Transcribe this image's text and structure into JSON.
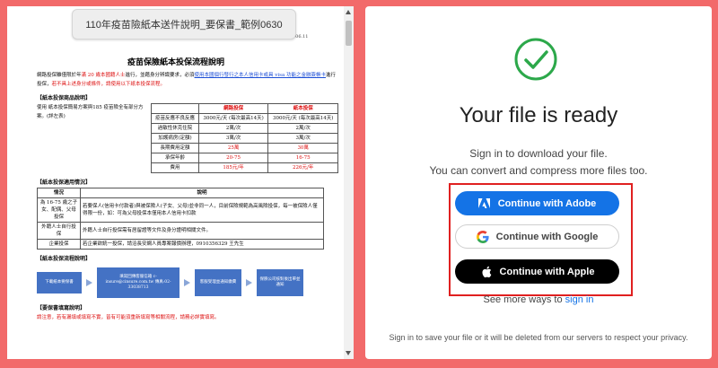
{
  "preview": {
    "file_name": "110年疫苗險紙本送件說明_要保書_範例0630",
    "date": "110.06.11",
    "doc_title": "疫苗保險紙本投保流程說明",
    "intro_1": "網路投保雖僅限於年",
    "intro_red": "滿 20 歲本國籍人士",
    "intro_2": "進行，並藉身分辨識要求，必須",
    "intro_blue": "使用本國個行發行之本人信用卡或具 visa 功能之金融簽帳卡",
    "intro_3": "進行投保，",
    "intro_4": "若不具上述身分或條件，請使用以下紙本投保流程。",
    "sec_product": "【紙本投保商品說明】",
    "product_text": "使用 紙本投保簡易方案與185 疫苗險全有部分方案。(詳左表)",
    "table": {
      "headers": [
        "",
        "網路投保",
        "紙本投保"
      ],
      "rows": [
        [
          "疫苗反應不良反應",
          "3000元/天 (每次最高14天)",
          "3000元/天 (每次最高14天)"
        ],
        [
          "過敏性休克住院",
          "2萬/次",
          "2萬/次"
        ],
        [
          "加護病房(定額)",
          "3萬/次",
          "3萬/次"
        ],
        [
          "長期費用定額",
          "25萬",
          "30萬"
        ],
        [
          "承保年齡",
          "20-75",
          "16-75"
        ],
        [
          "費用",
          "185元/年",
          "226元/年"
        ]
      ]
    },
    "sec_apply": "【紙本投保適用情況】",
    "apply_headers": [
      "情況",
      "說明"
    ],
    "apply_rows": [
      [
        "為 16-75 歲之子女、配偶、父母投保",
        "若要保人(信用卡付款者)與被保險人(子女、父母)並非同一人，目前保險規範為高風險投保，每一被保險人僅得限一份，如：可為父母投保本僅用本人信用卡扣款"
      ],
      [
        "外籍人士自行投保",
        "外籍人士自行投保需有居留證等文件及身分證明相關文件。"
      ],
      [
        "企業投保",
        "若企業欲統一投保，請洽長安網人員專案報價辦理，0910356329 王先生"
      ]
    ],
    "sec_flow": "【紙本投保流程說明】",
    "flow_steps": [
      "下載紙本要保書",
      "填寫回傳客服信箱 c-insure@cinsure.com.tw 傳真:02-33038713",
      "客服受理並通知繳費",
      "保險公司核對後出單並通知"
    ],
    "sec_notes": "【要保書填寫說明】",
    "notes_text": "請注意，若有漏填或填寫不實，皆有可能須重新填寫等相關流程，請務必詳實填寫。"
  },
  "panel": {
    "title": "Your file is ready",
    "line1": "Sign in to download your file.",
    "line2": "You can convert and compress more files too.",
    "btn_adobe": "Continue with Adobe",
    "btn_google": "Continue with Google",
    "btn_apple": "Continue with Apple",
    "more_prefix": "See more ways to",
    "more_link": "sign in",
    "footer": "Sign in to save your file or it will be deleted from our servers to respect your privacy."
  },
  "colors": {
    "background": "#f26a6a",
    "success": "#2ca84a",
    "adobe_blue": "#1473e6",
    "highlight": "#e02020"
  },
  "icons": [
    "check-icon",
    "adobe-icon",
    "google-icon",
    "apple-icon"
  ]
}
